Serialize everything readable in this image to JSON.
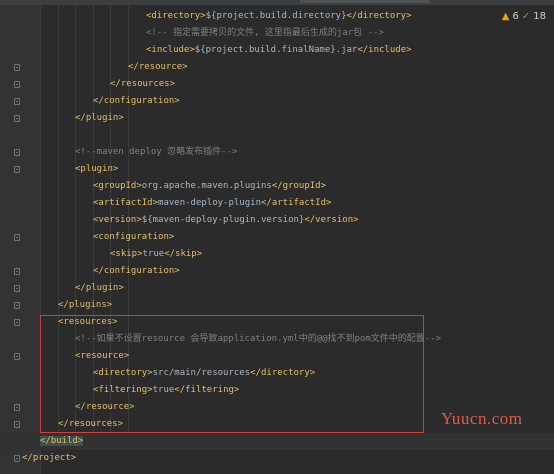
{
  "editor": {
    "lines": [
      {
        "tokens": [
          {
            "t": "tag",
            "v": "<directory>"
          },
          {
            "t": "text",
            "v": "${project.build.directory}"
          },
          {
            "t": "tag",
            "v": "</directory>"
          }
        ]
      },
      {
        "tokens": [
          {
            "t": "comment",
            "v": "<!-- 指定需要拷贝的文件, 这里指最后生成的jar包 -->"
          }
        ]
      },
      {
        "tokens": [
          {
            "t": "tag",
            "v": "<include>"
          },
          {
            "t": "text",
            "v": "${project.build.finalName}.jar"
          },
          {
            "t": "tag",
            "v": "</include>"
          }
        ]
      },
      {
        "tokens": [
          {
            "t": "tag",
            "v": "</resource>"
          }
        ]
      },
      {
        "tokens": [
          {
            "t": "tag",
            "v": "</resources>"
          }
        ]
      },
      {
        "tokens": [
          {
            "t": "tag",
            "v": "</configuration>"
          }
        ]
      },
      {
        "tokens": [
          {
            "t": "tag",
            "v": "</plugin>"
          }
        ]
      },
      {
        "tokens": []
      },
      {
        "tokens": [
          {
            "t": "comment",
            "v": "<!--maven deploy 忽略发布插件-->"
          }
        ]
      },
      {
        "tokens": [
          {
            "t": "tag",
            "v": "<plugin>"
          }
        ]
      },
      {
        "tokens": [
          {
            "t": "tag",
            "v": "<groupId>"
          },
          {
            "t": "text",
            "v": "org.apache.maven.plugins"
          },
          {
            "t": "tag",
            "v": "</groupId>"
          }
        ]
      },
      {
        "tokens": [
          {
            "t": "tag",
            "v": "<artifactId>"
          },
          {
            "t": "text",
            "v": "maven-deploy-plugin"
          },
          {
            "t": "tag",
            "v": "</artifactId>"
          }
        ]
      },
      {
        "tokens": [
          {
            "t": "tag",
            "v": "<version>"
          },
          {
            "t": "text",
            "v": "${maven-deploy-plugin.version}"
          },
          {
            "t": "tag",
            "v": "</version>"
          }
        ]
      },
      {
        "tokens": [
          {
            "t": "tag",
            "v": "<configuration>"
          }
        ]
      },
      {
        "tokens": [
          {
            "t": "tag",
            "v": "<skip>"
          },
          {
            "t": "text",
            "v": "true"
          },
          {
            "t": "tag",
            "v": "</skip>"
          }
        ]
      },
      {
        "tokens": [
          {
            "t": "tag",
            "v": "</configuration>"
          }
        ]
      },
      {
        "tokens": [
          {
            "t": "tag",
            "v": "</plugin>"
          }
        ]
      },
      {
        "tokens": [
          {
            "t": "tag",
            "v": "</plugins>"
          }
        ]
      },
      {
        "tokens": [
          {
            "t": "tag",
            "v": "<resources>"
          }
        ]
      },
      {
        "tokens": [
          {
            "t": "comment",
            "v": "<!--如果不设置resource 会导致application.yml中的@@找不到pom文件中的配置-->"
          }
        ]
      },
      {
        "tokens": [
          {
            "t": "tag",
            "v": "<resource>"
          }
        ]
      },
      {
        "tokens": [
          {
            "t": "tag",
            "v": "<directory>"
          },
          {
            "t": "text",
            "v": "src/main/resources"
          },
          {
            "t": "tag",
            "v": "</directory>"
          }
        ]
      },
      {
        "tokens": [
          {
            "t": "tag",
            "v": "<filtering>"
          },
          {
            "t": "text",
            "v": "true"
          },
          {
            "t": "tag",
            "v": "</filtering>"
          }
        ]
      },
      {
        "tokens": [
          {
            "t": "tag",
            "v": "</resource>"
          }
        ]
      },
      {
        "tokens": [
          {
            "t": "tag",
            "v": "</resources>"
          }
        ]
      },
      {
        "tokens": [
          {
            "t": "tag",
            "v": "</build>"
          }
        ]
      },
      {
        "tokens": [
          {
            "t": "tag",
            "v": "</project>"
          }
        ]
      }
    ]
  },
  "status": {
    "warning_count": "6",
    "warning_icon": "warning-triangle-icon",
    "check_count": "18",
    "check_icon": "check-icon"
  },
  "watermark": "Yuucn.com",
  "colors": {
    "background": "#2b2b2b",
    "tag": "#e8bf6a",
    "text": "#a9b7c6",
    "comment": "#808080",
    "highlight_box": "#d83b3b",
    "watermark": "#e05a4f"
  }
}
